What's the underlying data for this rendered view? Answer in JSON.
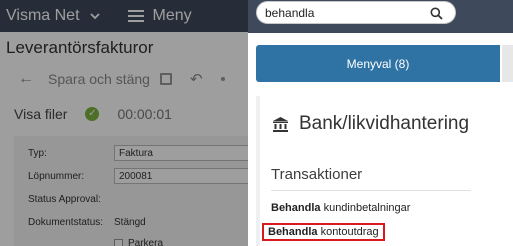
{
  "app": {
    "brand": "Visma Net",
    "menu_label": "Meny",
    "page_title": "Leverantörsfakturor",
    "toolbar": {
      "save_close_label": "Spara och stäng"
    },
    "files": {
      "label": "Visa filer",
      "timer": "00:00:01"
    },
    "form": {
      "type_label": "Typ:",
      "type_value": "Faktura",
      "number_label": "Löpnummer:",
      "number_value": "200081",
      "approval_label": "Status Approval:",
      "docstatus_label": "Dokumentstatus:",
      "docstatus_value": "Stängd",
      "park_label": "Parkera"
    }
  },
  "search": {
    "value": "behandla"
  },
  "tabs": {
    "active_label": "Menyval  (8)"
  },
  "results": {
    "section_title": "Bank/likvidhantering",
    "subsection_title": "Transaktioner",
    "items": [
      {
        "bold": "Behandla",
        "rest": " kundinbetalningar"
      },
      {
        "bold": "Behandla",
        "rest": " kontoutdrag"
      }
    ]
  },
  "colors": {
    "topbar": "#3e4a5b",
    "tab_active": "#2f73a4",
    "highlight_border": "#d9181f"
  }
}
